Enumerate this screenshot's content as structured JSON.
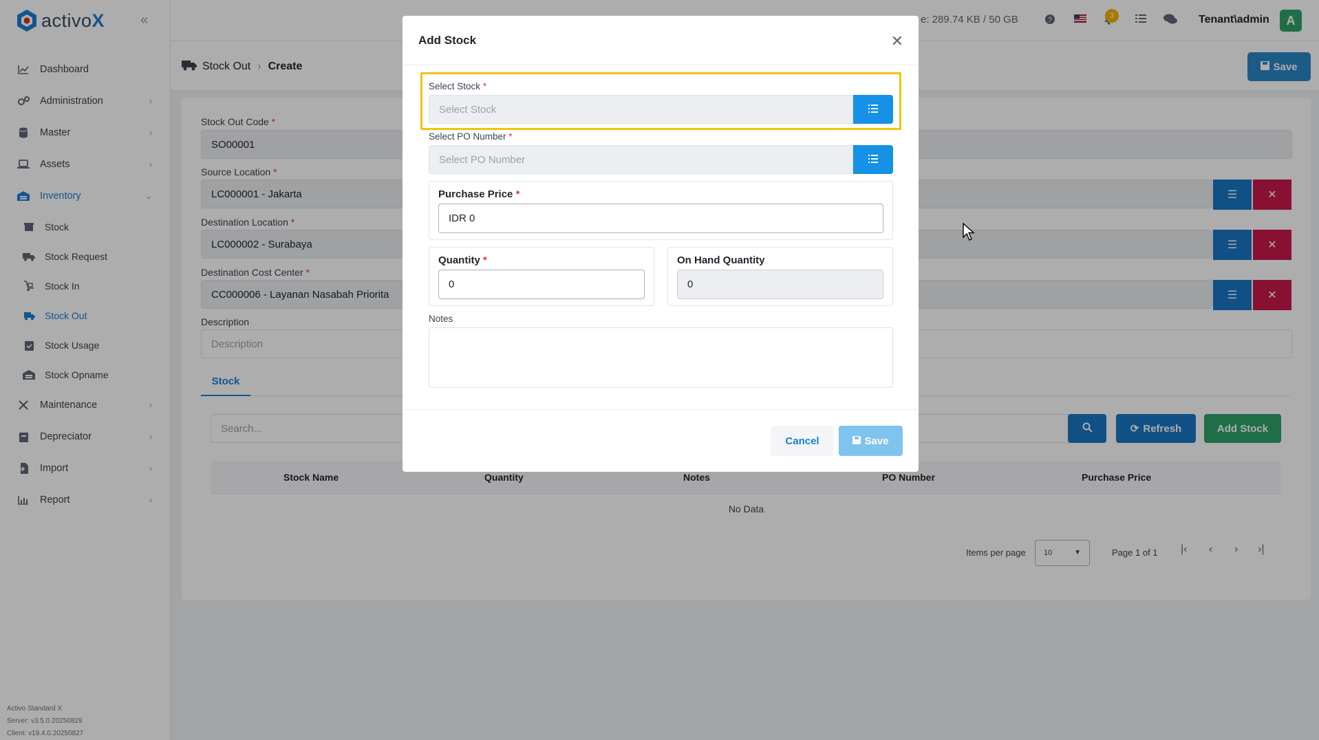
{
  "brand": {
    "name_part1": "activo",
    "name_part2": "X"
  },
  "topbar": {
    "storage_text": "e: 289.74 KB / 50 GB",
    "notification_count": "3",
    "user_name": "Tenant\\admin",
    "avatar_letter": "A"
  },
  "sidebar": {
    "items": [
      {
        "label": "Dashboard"
      },
      {
        "label": "Administration"
      },
      {
        "label": "Master"
      },
      {
        "label": "Assets"
      },
      {
        "label": "Inventory"
      },
      {
        "label": "Maintenance"
      },
      {
        "label": "Depreciator"
      },
      {
        "label": "Import"
      },
      {
        "label": "Report"
      }
    ],
    "inventory_sub": [
      {
        "label": "Stock"
      },
      {
        "label": "Stock Request"
      },
      {
        "label": "Stock In"
      },
      {
        "label": "Stock Out"
      },
      {
        "label": "Stock Usage"
      },
      {
        "label": "Stock Opname"
      }
    ],
    "footer": {
      "product": "Activo Standard X",
      "server": "Server: v3.5.0.20250829",
      "client": "Client: v19.4.0.20250827"
    }
  },
  "breadcrumb": {
    "parent": "Stock Out",
    "current": "Create"
  },
  "header": {
    "save_label": "Save"
  },
  "form": {
    "code_label": "Stock Out Code",
    "code_value": "SO00001",
    "source_label": "Source Location",
    "source_value": "LC000001 - Jakarta",
    "dest_label": "Destination Location",
    "dest_value": "LC000002 - Surabaya",
    "cost_label": "Destination Cost Center",
    "cost_value": "CC000006 - Layanan Nasabah Priorita",
    "desc_label": "Description",
    "desc_placeholder": "Description"
  },
  "tabs": {
    "stock": "Stock"
  },
  "table": {
    "search_placeholder": "Search...",
    "refresh_label": "Refresh",
    "add_label": "Add Stock",
    "columns": [
      "Stock Name",
      "Quantity",
      "Notes",
      "PO Number",
      "Purchase Price"
    ],
    "empty_text": "No Data",
    "items_per_page_label": "Items per page",
    "items_per_page_value": "10",
    "page_info": "Page 1 of 1"
  },
  "modal": {
    "title": "Add Stock",
    "select_stock_label": "Select Stock",
    "select_stock_placeholder": "Select Stock",
    "select_po_label": "Select PO Number",
    "select_po_placeholder": "Select PO Number",
    "purchase_price_label": "Purchase Price",
    "purchase_price_value": "IDR 0",
    "quantity_label": "Quantity",
    "quantity_value": "0",
    "on_hand_label": "On Hand Quantity",
    "on_hand_value": "0",
    "notes_label": "Notes",
    "cancel_label": "Cancel",
    "save_label": "Save"
  },
  "colors": {
    "primary": "#1976c4",
    "accent_blue": "#1591e6",
    "danger": "#c9184a",
    "success": "#2ea36b",
    "highlight": "#f4c20d"
  }
}
